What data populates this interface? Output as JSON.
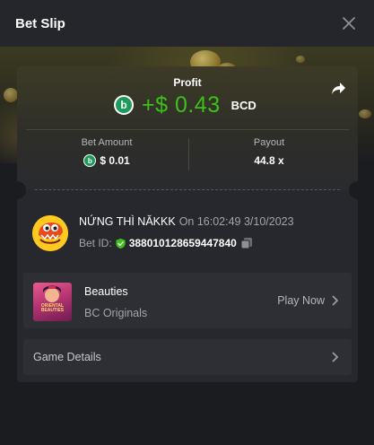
{
  "header": {
    "title": "Bet Slip"
  },
  "profit": {
    "label": "Profit",
    "coin_symbol": "b",
    "value": "+$ 0.43",
    "currency": "BCD"
  },
  "stats": {
    "bet_amount_label": "Bet Amount",
    "bet_amount_value": "$ 0.01",
    "payout_label": "Payout",
    "payout_value": "44.8 x"
  },
  "user": {
    "name": "NỨNG THÌ NĂKKK",
    "time_text": "On 16:02:49 3/10/2023",
    "bet_id_label": "Bet ID:",
    "bet_id_value": "388010128659447840"
  },
  "game": {
    "title": "Beauties",
    "subtitle": "BC Originals",
    "play_label": "Play Now",
    "thumb_text": "ORIENTAL BEAUTIES"
  },
  "details": {
    "label": "Game Details"
  },
  "colors": {
    "profit_green": "#3bc117",
    "coin_green": "#1e9b5a",
    "card_bg": "#26282d",
    "row_bg": "#2d2f34"
  },
  "icons": {
    "close": "close-icon",
    "share": "share-icon",
    "shield": "shield-check-icon",
    "copy": "copy-icon",
    "chevron": "chevron-right-icon"
  }
}
